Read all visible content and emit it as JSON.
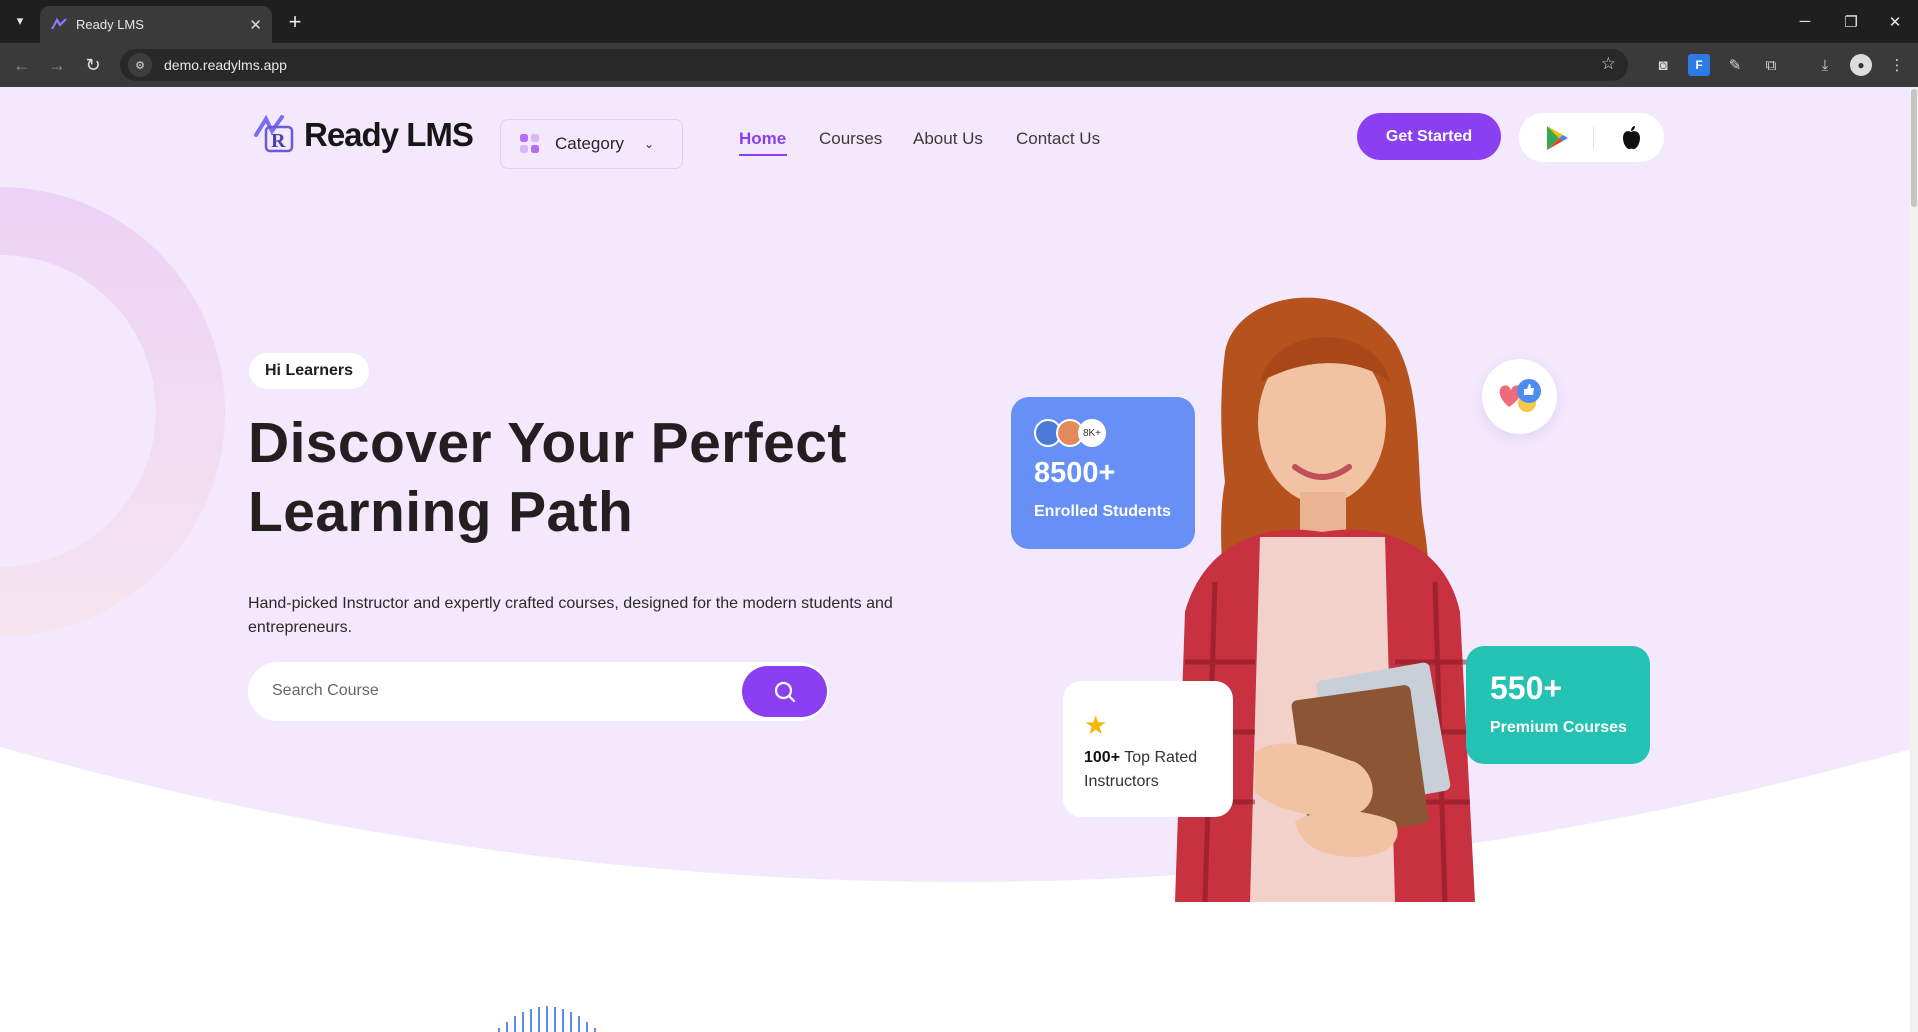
{
  "browser": {
    "tab_title": "Ready LMS",
    "url": "demo.readylms.app"
  },
  "colors": {
    "accent": "#8a3ff0",
    "hero_bg": "#f3e8fc",
    "students_card": "#6690f5",
    "courses_card": "#24c2b3",
    "star": "#f5b700"
  },
  "header": {
    "logo_text": "Ready LMS",
    "category_label": "Category",
    "nav": [
      "Home",
      "Courses",
      "About Us",
      "Contact Us"
    ],
    "active_nav": "Home",
    "cta_label": "Get Started",
    "store_icons": [
      "google-play-icon",
      "apple-icon"
    ]
  },
  "hero": {
    "chip": "Hi Learners",
    "headline_line1": "Discover Your Perfect",
    "headline_line2": "Learning Path",
    "subtitle": "Hand-picked Instructor and expertly crafted courses, designed for the modern students and entrepreneurs.",
    "search_placeholder": "Search Course"
  },
  "stats": {
    "students_avatar_badge": "8K+",
    "students_value": "8500+",
    "students_label": "Enrolled Students",
    "courses_value": "550+",
    "courses_label": "Premium Courses",
    "instructors_value": "100+",
    "instructors_label": "Top Rated Instructors"
  }
}
